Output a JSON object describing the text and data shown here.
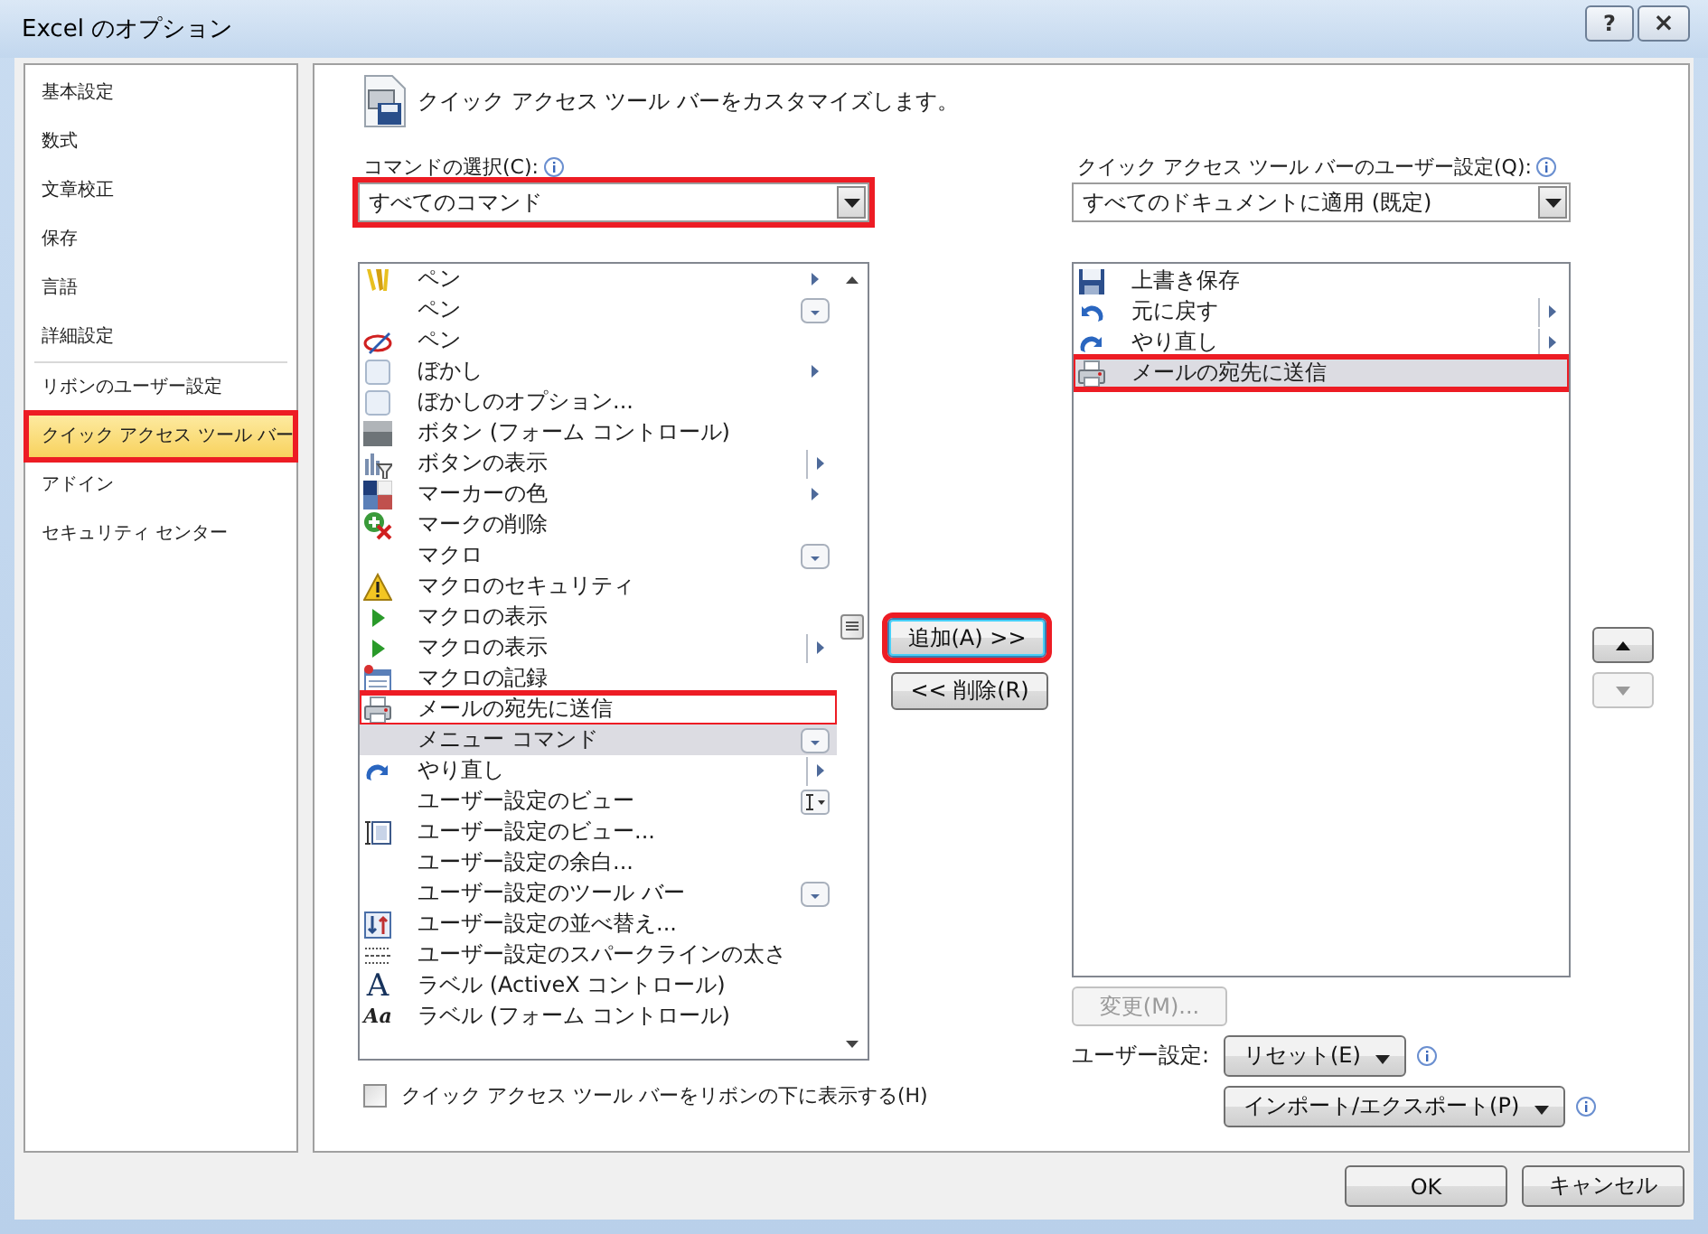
{
  "window": {
    "title": "Excel のオプション",
    "buttons": [
      {
        "kind": "help",
        "label": "?"
      },
      {
        "kind": "close",
        "label": "×"
      }
    ]
  },
  "sidebar": {
    "groups": [
      [
        {
          "label": "基本設定",
          "selected": false,
          "annotated": false
        },
        {
          "label": "数式",
          "selected": false,
          "annotated": false
        },
        {
          "label": "文章校正",
          "selected": false,
          "annotated": false
        },
        {
          "label": "保存",
          "selected": false,
          "annotated": false
        },
        {
          "label": "言語",
          "selected": false,
          "annotated": false
        },
        {
          "label": "詳細設定",
          "selected": false,
          "annotated": false
        }
      ],
      [
        {
          "label": "リボンのユーザー設定",
          "selected": false,
          "annotated": false
        },
        {
          "label": "クイック アクセス ツール バー",
          "selected": true,
          "annotated": true
        },
        {
          "label": "アドイン",
          "selected": false,
          "annotated": false
        },
        {
          "label": "セキュリティ センター",
          "selected": false,
          "annotated": false
        }
      ]
    ]
  },
  "header": {
    "text": "クイック アクセス ツール バーをカスタマイズします。"
  },
  "commands": {
    "label": "コマンドの選択(C):",
    "dropdown": {
      "value": "すべてのコマンド",
      "annotated": true
    },
    "items": [
      {
        "label": "ペン",
        "kind": "pencils",
        "submenu": true,
        "split": false,
        "dropdown": false,
        "selected": false,
        "annotated": false
      },
      {
        "label": "ペン",
        "kind": "plain",
        "submenu": false,
        "split": false,
        "dropdown": true,
        "selected": false,
        "annotated": false
      },
      {
        "label": "ペン",
        "kind": "pen",
        "submenu": false,
        "split": false,
        "dropdown": false,
        "selected": false,
        "annotated": false
      },
      {
        "label": "ぼかし",
        "kind": "square",
        "submenu": true,
        "split": false,
        "dropdown": false,
        "selected": false,
        "annotated": false
      },
      {
        "label": "ぼかしのオプション...",
        "kind": "square",
        "submenu": false,
        "split": false,
        "dropdown": false,
        "selected": false,
        "annotated": false
      },
      {
        "label": "ボタン (フォーム コントロール)",
        "kind": "bar",
        "submenu": false,
        "split": false,
        "dropdown": false,
        "selected": false,
        "annotated": false
      },
      {
        "label": "ボタンの表示",
        "kind": "chart",
        "submenu": true,
        "split": true,
        "dropdown": false,
        "selected": false,
        "annotated": false
      },
      {
        "label": "マーカーの色",
        "kind": "colors",
        "submenu": true,
        "split": false,
        "dropdown": false,
        "selected": false,
        "annotated": false
      },
      {
        "label": "マークの削除",
        "kind": "delete",
        "submenu": false,
        "split": false,
        "dropdown": false,
        "selected": false,
        "annotated": false
      },
      {
        "label": "マクロ",
        "kind": "plain",
        "submenu": false,
        "split": false,
        "dropdown": true,
        "selected": false,
        "annotated": false
      },
      {
        "label": "マクロのセキュリティ",
        "kind": "warning",
        "submenu": false,
        "split": false,
        "dropdown": false,
        "selected": false,
        "annotated": false
      },
      {
        "label": "マクロの表示",
        "kind": "play",
        "submenu": false,
        "split": false,
        "dropdown": false,
        "selected": false,
        "annotated": false
      },
      {
        "label": "マクロの表示",
        "kind": "play",
        "submenu": true,
        "split": true,
        "dropdown": false,
        "selected": false,
        "annotated": false
      },
      {
        "label": "マクロの記録",
        "kind": "record",
        "submenu": false,
        "split": false,
        "dropdown": false,
        "selected": false,
        "annotated": false
      },
      {
        "label": "メールの宛先に送信",
        "kind": "printer",
        "submenu": false,
        "split": false,
        "dropdown": false,
        "selected": false,
        "annotated": true
      },
      {
        "label": "メニュー コマンド",
        "kind": "plain",
        "submenu": false,
        "split": false,
        "dropdown": true,
        "selected": true,
        "annotated": false
      },
      {
        "label": "やり直し",
        "kind": "redo",
        "submenu": true,
        "split": true,
        "dropdown": false,
        "selected": false,
        "annotated": false
      },
      {
        "label": "ユーザー設定のビュー",
        "kind": "textbox",
        "submenu": false,
        "split": false,
        "dropdown": true,
        "selected": false,
        "annotated": false
      },
      {
        "label": "ユーザー設定のビュー...",
        "kind": "frame",
        "submenu": false,
        "split": false,
        "dropdown": false,
        "selected": false,
        "annotated": false
      },
      {
        "label": "ユーザー設定の余白...",
        "kind": "plain",
        "submenu": false,
        "split": false,
        "dropdown": false,
        "selected": false,
        "annotated": false
      },
      {
        "label": "ユーザー設定のツール バー",
        "kind": "plain",
        "submenu": false,
        "split": false,
        "dropdown": true,
        "selected": false,
        "annotated": false
      },
      {
        "label": "ユーザー設定の並べ替え...",
        "kind": "sort",
        "submenu": false,
        "split": false,
        "dropdown": false,
        "selected": false,
        "annotated": false
      },
      {
        "label": "ユーザー設定のスパークラインの太さ",
        "kind": "dots",
        "submenu": false,
        "split": false,
        "dropdown": false,
        "selected": false,
        "annotated": false
      },
      {
        "label": "ラベル (ActiveX コントロール)",
        "kind": "glyph",
        "glyph": "A",
        "submenu": false,
        "split": false,
        "dropdown": false,
        "selected": false,
        "annotated": false
      },
      {
        "label": "ラベル (フォーム コントロール)",
        "kind": "glyph",
        "glyph": "Aa",
        "submenu": false,
        "split": false,
        "dropdown": false,
        "selected": false,
        "annotated": false
      }
    ],
    "checkbox": {
      "label": "クイック アクセス ツール バーをリボンの下に表示する(H)",
      "checked": false
    }
  },
  "transfer_buttons": [
    {
      "label": "追加(A) >>",
      "focused": true,
      "annotated": true
    },
    {
      "label": "<< 削除(R)",
      "focused": false,
      "annotated": false
    }
  ],
  "toolbar_settings": {
    "label": "クイック アクセス ツール バーのユーザー設定(Q):",
    "dropdown": {
      "value": "すべてのドキュメントに適用 (既定)",
      "annotated": false
    },
    "items": [
      {
        "label": "上書き保存",
        "kind": "save",
        "submenu": false,
        "split": false,
        "dropdown": false,
        "selected": false,
        "annotated": false
      },
      {
        "label": "元に戻す",
        "kind": "undo",
        "submenu": true,
        "split": true,
        "dropdown": false,
        "selected": false,
        "annotated": false
      },
      {
        "label": "やり直し",
        "kind": "redo",
        "submenu": true,
        "split": true,
        "dropdown": false,
        "selected": false,
        "annotated": false
      },
      {
        "label": "メールの宛先に送信",
        "kind": "printer",
        "submenu": false,
        "split": false,
        "dropdown": false,
        "selected": true,
        "annotated": true
      }
    ],
    "modify_button": {
      "label": "変更(M)...",
      "disabled": true
    },
    "customizations_label": "ユーザー設定:",
    "menu_buttons": [
      {
        "label": "リセット(E)"
      },
      {
        "label": "インポート/エクスポート(P)"
      }
    ]
  },
  "move_buttons": [
    {
      "kind": "up",
      "disabled": false
    },
    {
      "kind": "down",
      "disabled": true
    }
  ],
  "footer_buttons": [
    "OK",
    "キャンセル"
  ]
}
